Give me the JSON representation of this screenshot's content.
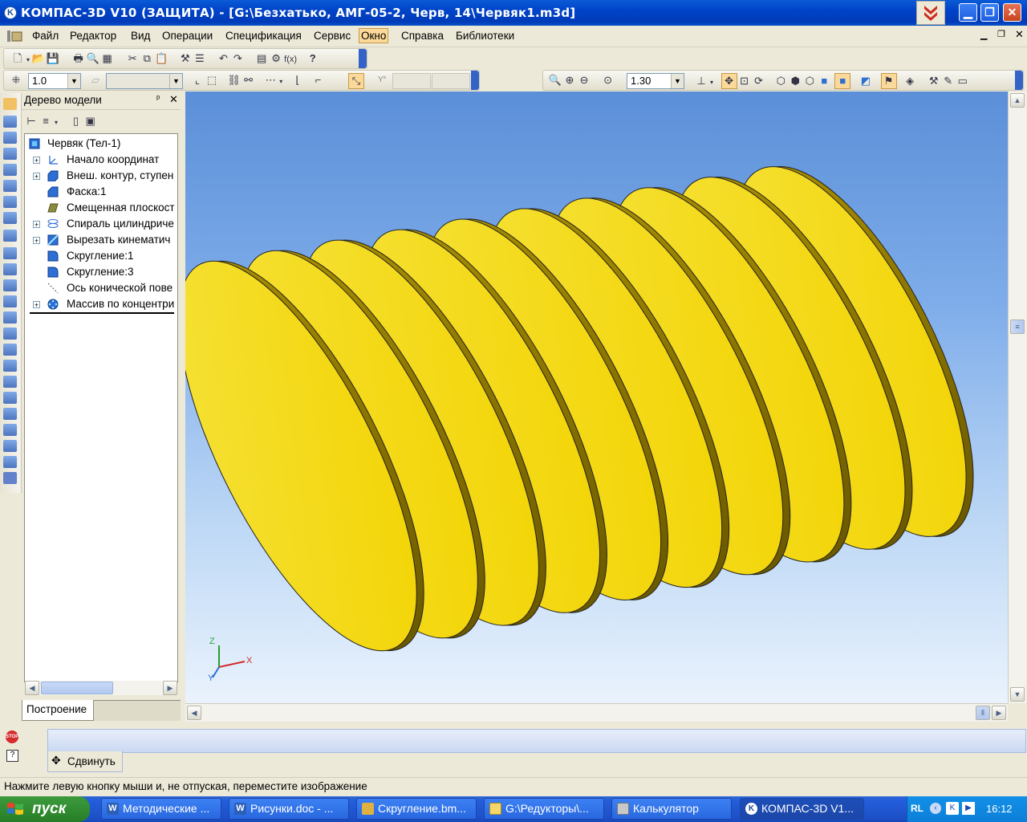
{
  "window": {
    "title": "КОМПАС-3D V10 (ЗАЩИТА) - [G:\\Безхатько, АМГ-05-2, Черв, 14\\Червяк1.m3d]"
  },
  "menu": {
    "items": [
      "Файл",
      "Редактор",
      "Вид",
      "Операции",
      "Спецификация",
      "Сервис",
      "Окно",
      "Справка",
      "Библиотеки"
    ],
    "active": "Окно"
  },
  "toolbar": {
    "step_value": "1.0",
    "zoom_value": "1.30"
  },
  "tree": {
    "title": "Дерево модели",
    "root": "Червяк (Тел-1)",
    "nodes": [
      {
        "label": "Начало координат",
        "expandable": true,
        "icon": "axes-icon"
      },
      {
        "label": "Внеш. контур, ступен",
        "expandable": true,
        "icon": "solid-icon"
      },
      {
        "label": "Фаска:1",
        "expandable": false,
        "icon": "chamfer-icon"
      },
      {
        "label": "Смещенная плоскост",
        "expandable": false,
        "icon": "plane-icon"
      },
      {
        "label": "Спираль цилиндриче",
        "expandable": true,
        "icon": "helix-icon"
      },
      {
        "label": "Вырезать кинематич",
        "expandable": true,
        "icon": "sweep-cut-icon"
      },
      {
        "label": "Скругление:1",
        "expandable": false,
        "icon": "fillet-icon"
      },
      {
        "label": "Скругление:3",
        "expandable": false,
        "icon": "fillet-icon"
      },
      {
        "label": "Ось конической пове",
        "expandable": false,
        "icon": "axis-icon"
      },
      {
        "label": "Массив по концентри",
        "expandable": true,
        "icon": "pattern-icon"
      }
    ],
    "tab": "Построение"
  },
  "viewport": {
    "axes": {
      "x": "X",
      "y": "Y",
      "z": "Z"
    },
    "model_color": "#f2d300"
  },
  "propbar": {
    "command": "Сдвинуть"
  },
  "status": {
    "text": "Нажмите левую кнопку мыши и, не отпуская, переместите изображение"
  },
  "taskbar": {
    "start": "пуск",
    "tasks": [
      {
        "label": "Методические ...",
        "icon": "word-icon"
      },
      {
        "label": "Рисунки.doc - ...",
        "icon": "word-icon"
      },
      {
        "label": "Скругление.bm...",
        "icon": "paint-icon"
      },
      {
        "label": "G:\\Редукторы\\...",
        "icon": "folder-icon"
      },
      {
        "label": "Калькулятор",
        "icon": "calculator-icon"
      },
      {
        "label": "КОМПАС-3D V1...",
        "icon": "kompas-icon",
        "active": true
      }
    ],
    "tray": {
      "lang": "RL",
      "time": "16:12"
    }
  }
}
